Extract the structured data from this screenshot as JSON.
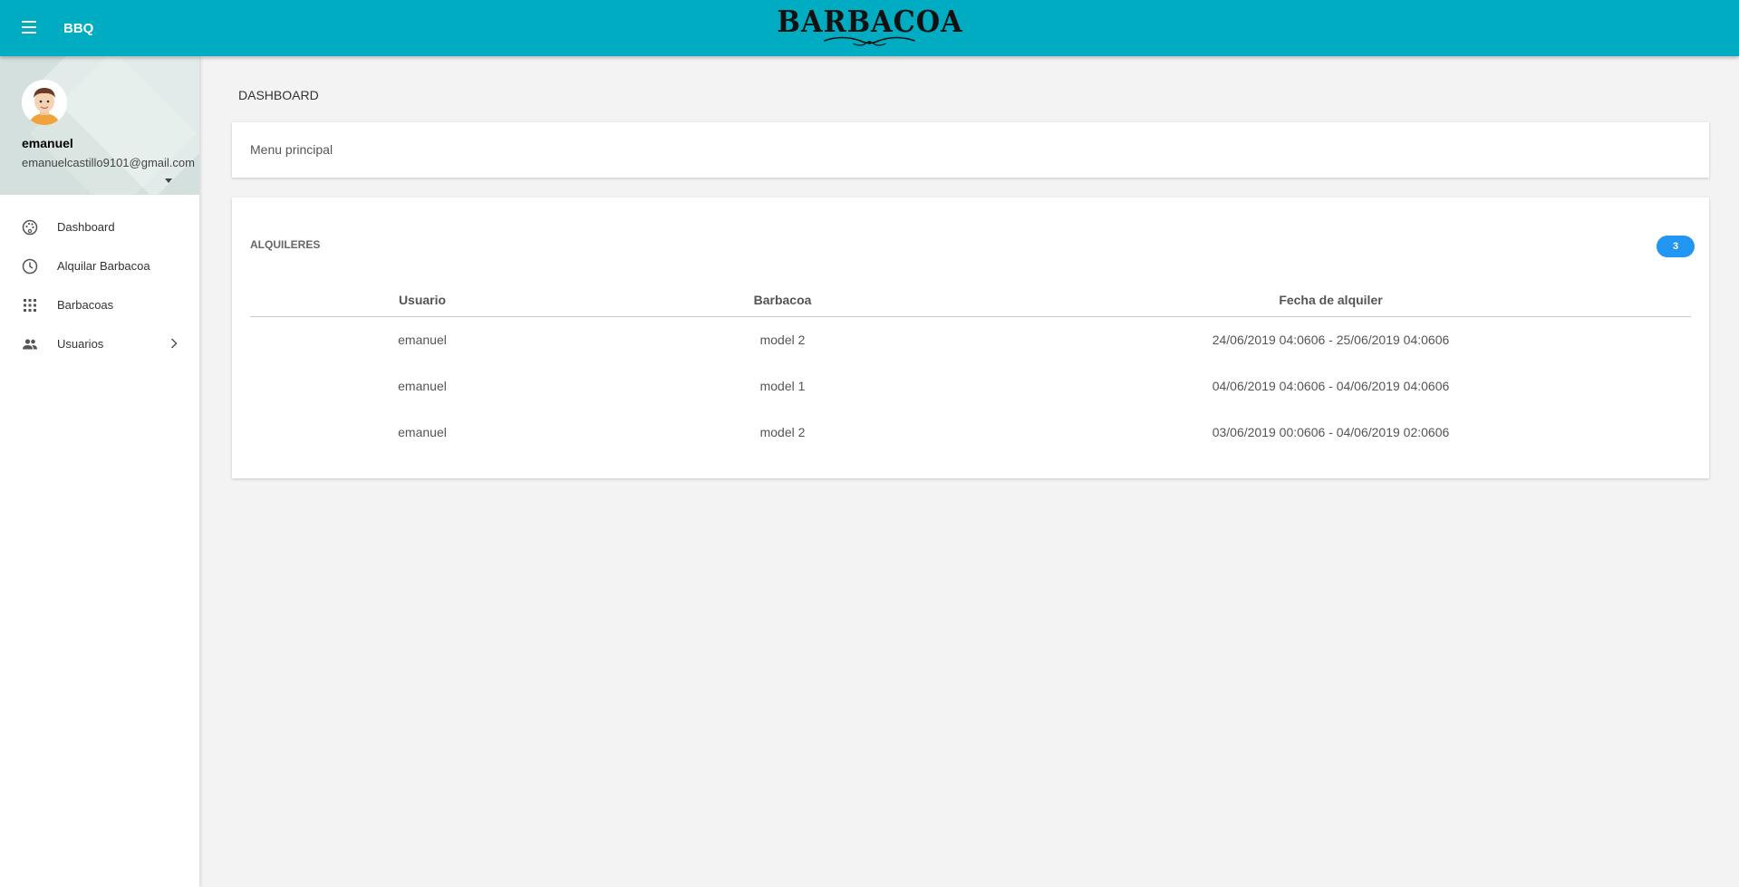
{
  "header": {
    "app_name": "BBQ",
    "logo_text": "BARBACOA"
  },
  "user": {
    "name": "emanuel",
    "email": "emanuelcastillo9101@gmail.com"
  },
  "sidebar": {
    "items": [
      {
        "label": "Dashboard",
        "icon": "palette-icon"
      },
      {
        "label": "Alquilar Barbacoa",
        "icon": "clock-icon"
      },
      {
        "label": "Barbacoas",
        "icon": "apps-grid-icon"
      },
      {
        "label": "Usuarios",
        "icon": "people-icon"
      }
    ]
  },
  "main": {
    "page_title": "DASHBOARD",
    "menu_card_text": "Menu principal",
    "rentals": {
      "title": "ALQUILERES",
      "count": "3",
      "columns": [
        "Usuario",
        "Barbacoa",
        "Fecha de alquiler"
      ],
      "rows": [
        [
          "emanuel",
          "model 2",
          "24/06/2019 04:0606 - 25/06/2019 04:0606"
        ],
        [
          "emanuel",
          "model 1",
          "04/06/2019 04:0606 - 04/06/2019 04:0606"
        ],
        [
          "emanuel",
          "model 2",
          "03/06/2019 00:0606 - 04/06/2019 02:0606"
        ]
      ]
    }
  },
  "colors": {
    "topbar": "#00acc1",
    "badge": "#2196f3",
    "user_panel": "#d3e0dd"
  }
}
